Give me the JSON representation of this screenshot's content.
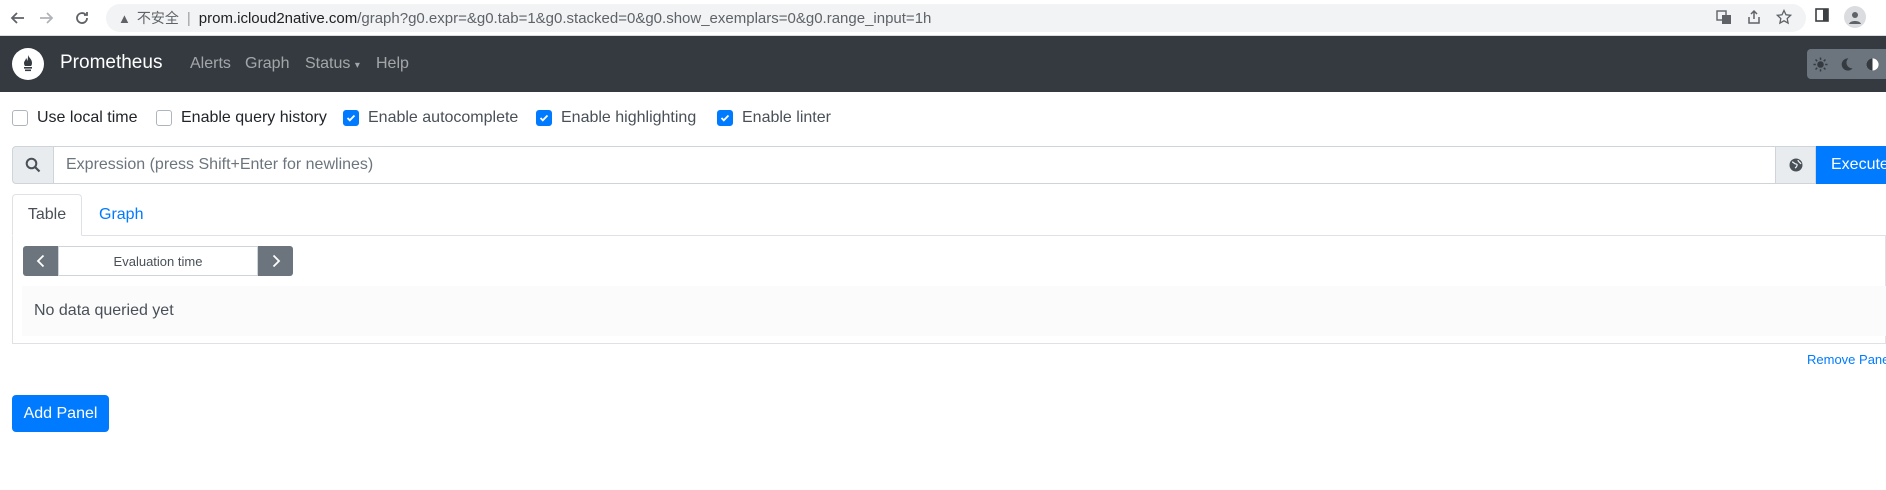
{
  "browser": {
    "insecure_label": "不安全",
    "url_host": "prom.icloud2native.com",
    "url_path": "/graph?g0.expr=&g0.tab=1&g0.stacked=0&g0.show_exemplars=0&g0.range_input=1h"
  },
  "navbar": {
    "brand": "Prometheus",
    "links": [
      "Alerts",
      "Graph",
      "Status",
      "Help"
    ]
  },
  "options": [
    {
      "label": "Use local time",
      "checked": false
    },
    {
      "label": "Enable query history",
      "checked": false
    },
    {
      "label": "Enable autocomplete",
      "checked": true
    },
    {
      "label": "Enable highlighting",
      "checked": true
    },
    {
      "label": "Enable linter",
      "checked": true
    }
  ],
  "expression": {
    "placeholder": "Expression (press Shift+Enter for newlines)",
    "execute_label": "Execute"
  },
  "tabs": {
    "active": "Table",
    "other": "Graph"
  },
  "evaluation": {
    "placeholder": "Evaluation time"
  },
  "result": {
    "empty_text": "No data queried yet"
  },
  "panel": {
    "remove_label": "Remove Panel",
    "add_label": "Add Panel"
  },
  "colors": {
    "navbar": "#343a40",
    "primary": "#007bff",
    "secondary": "#6c757d"
  }
}
